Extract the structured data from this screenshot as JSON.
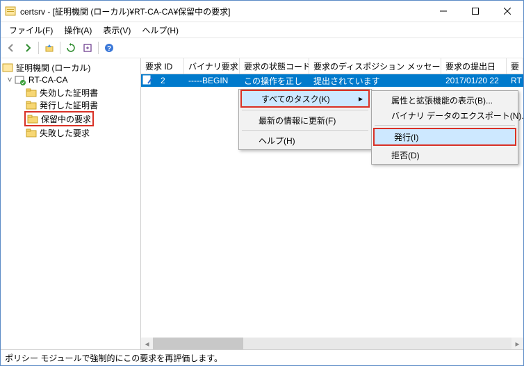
{
  "title": "certsrv - [証明機関 (ローカル)¥RT-CA-CA¥保留中の要求]",
  "menu": {
    "file": "ファイル(F)",
    "action": "操作(A)",
    "view": "表示(V)",
    "help": "ヘルプ(H)"
  },
  "tree": {
    "root": "証明機関 (ローカル)",
    "ca": "RT-CA-CA",
    "revoked": "失効した証明書",
    "issued": "発行した証明書",
    "pending": "保留中の要求",
    "failed": "失敗した要求"
  },
  "cols": {
    "id": "要求 ID",
    "bin": "バイナリ要求",
    "status": "要求の状態コード",
    "disp": "要求のディスポジション メッセージ",
    "date": "要求の提出日",
    "extra": "要"
  },
  "row": {
    "id": "2",
    "bin": "-----BEGIN",
    "status": "この操作を正し",
    "disp": "提出されています",
    "date": "2017/01/20 22",
    "extra": "RT"
  },
  "ctx1": {
    "allTasks": "すべてのタスク(K)",
    "refresh": "最新の情報に更新(F)",
    "help": "ヘルプ(H)"
  },
  "ctx2": {
    "attrs": "属性と拡張機能の表示(B)...",
    "export": "バイナリ データのエクスポート(N)...",
    "issue": "発行(I)",
    "deny": "拒否(D)"
  },
  "status": "ポリシー モジュールで強制的にこの要求を再評価します。"
}
